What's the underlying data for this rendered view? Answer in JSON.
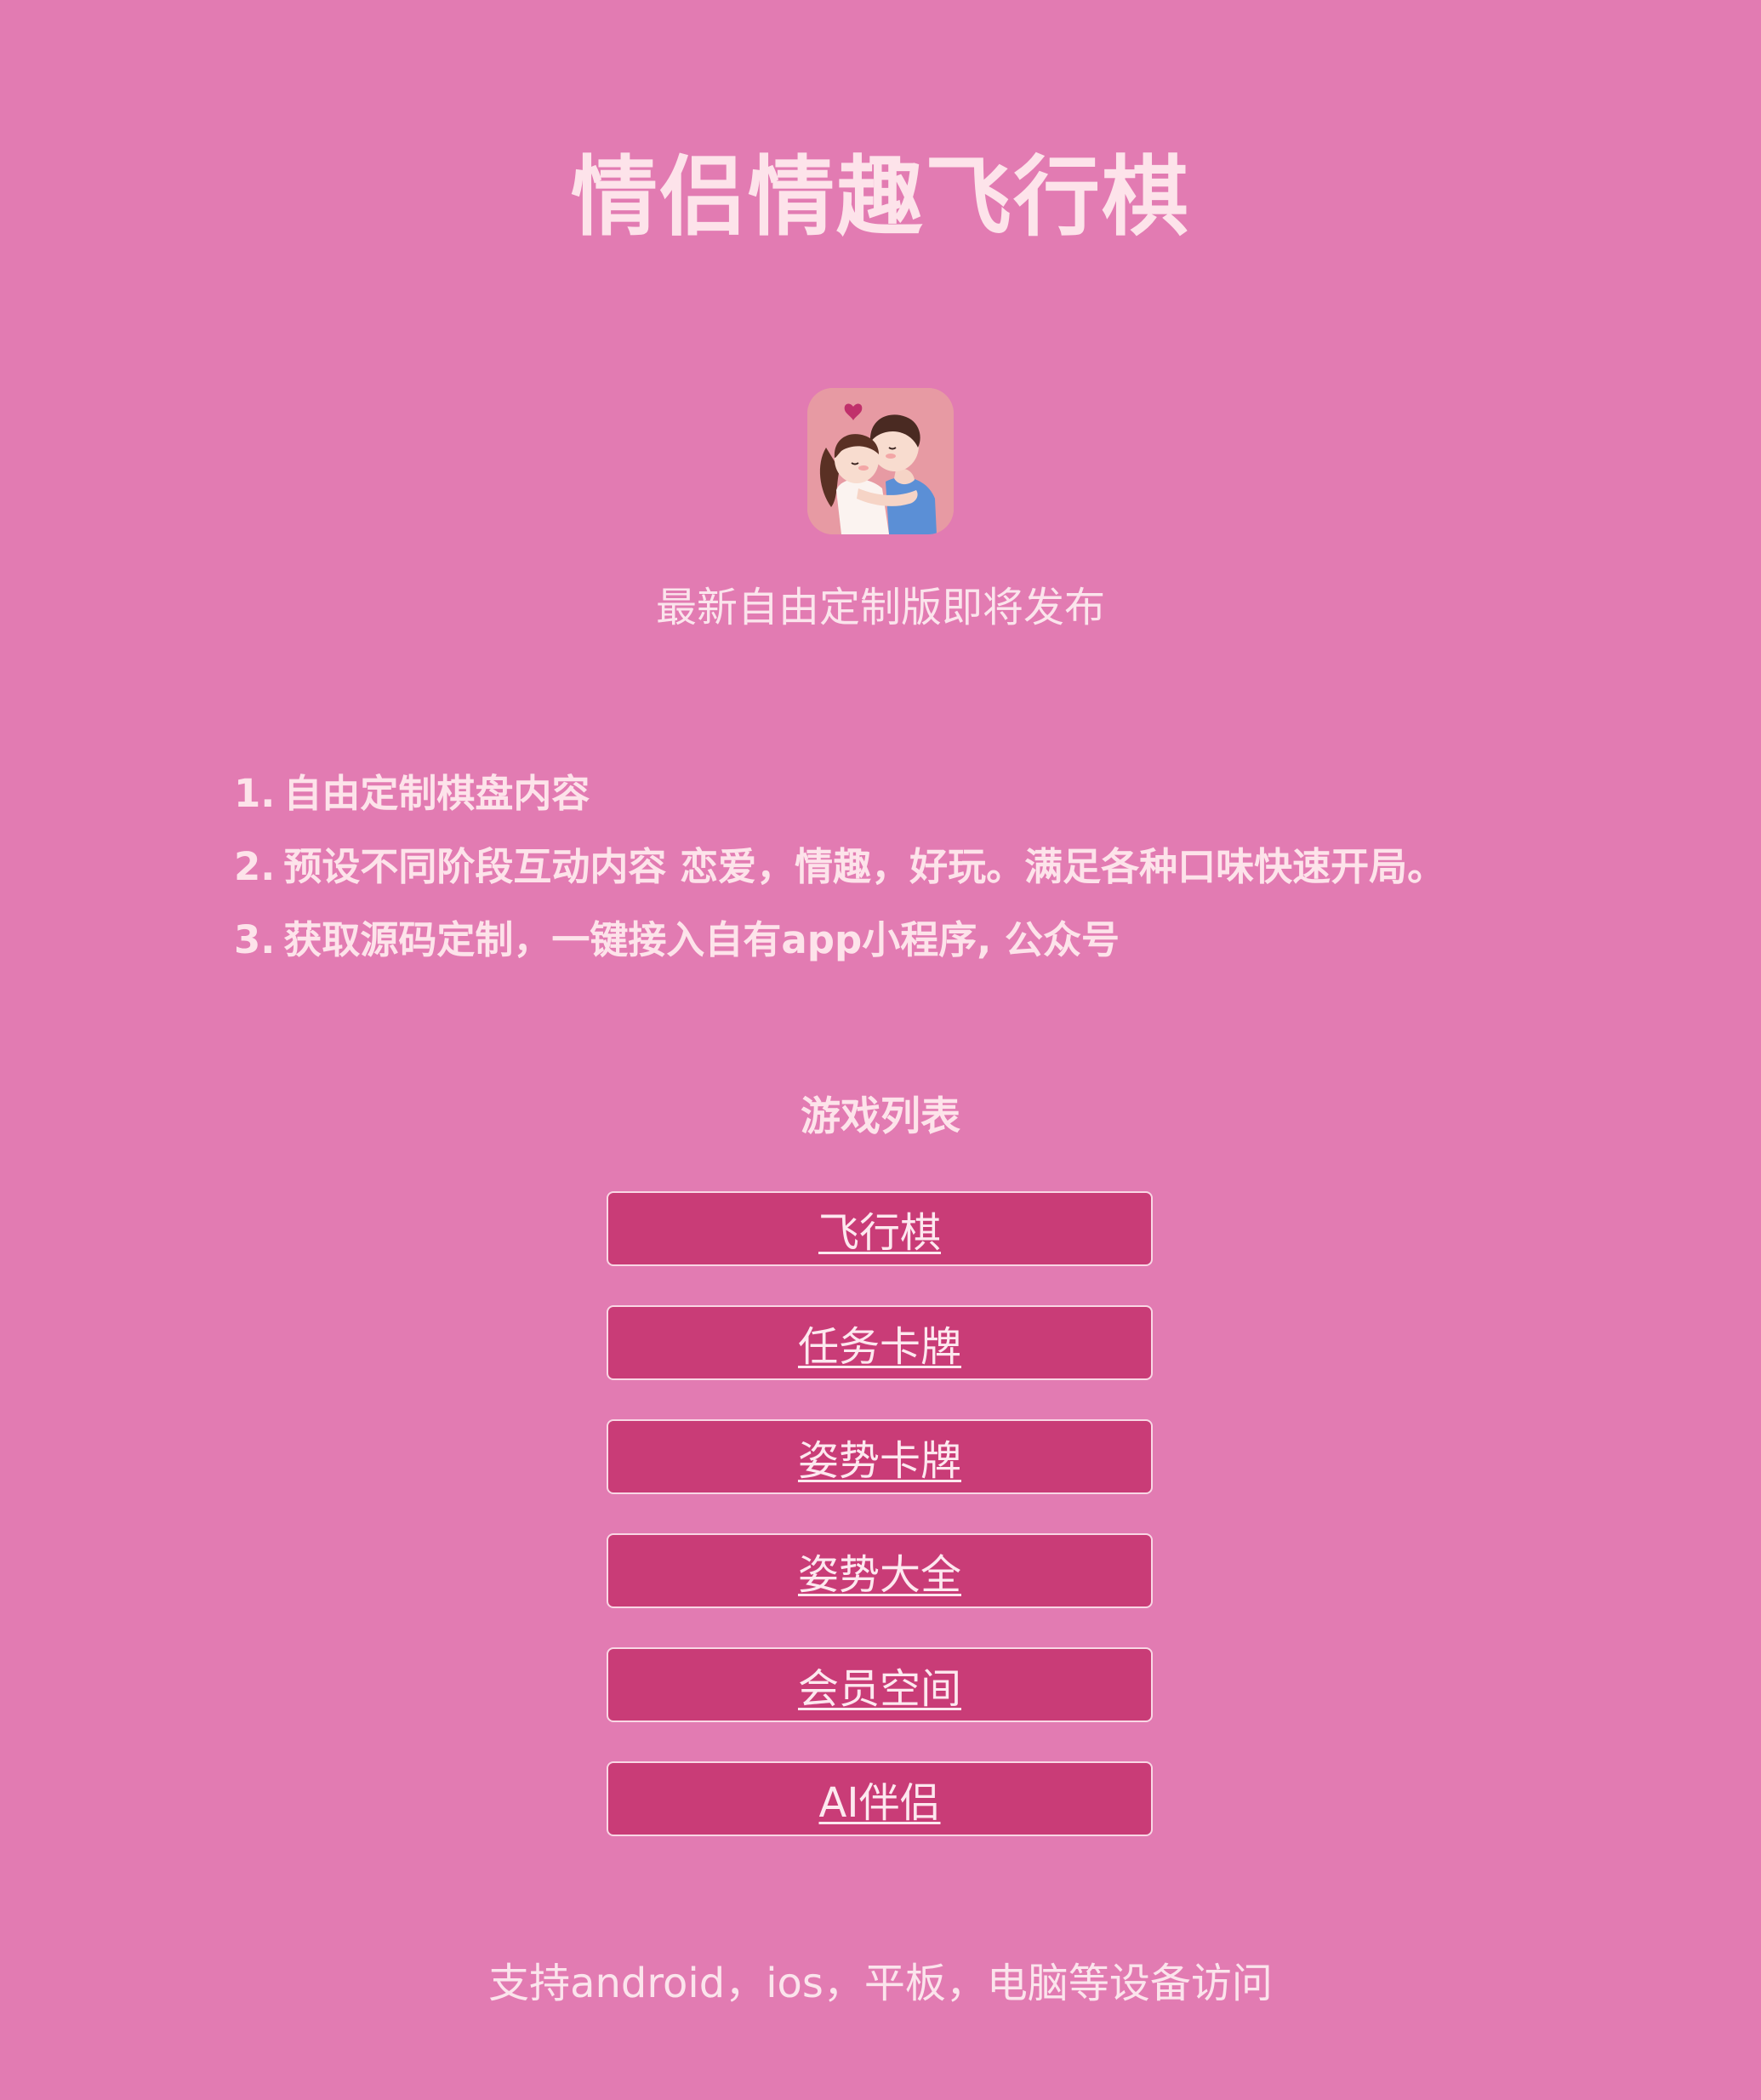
{
  "header": {
    "title": "情侣情趣飞行棋"
  },
  "icon": {
    "name": "couple-hug-app-icon"
  },
  "subtitle": "最新自由定制版即将发布",
  "features": [
    {
      "num": "1.",
      "text": "自由定制棋盘内容"
    },
    {
      "num": "2.",
      "text": "预设不同阶段互动内容 恋爱，情趣，好玩。满足各种口味快速开局。"
    },
    {
      "num": "3.",
      "text": "获取源码定制，一键接入自有app小程序, 公众号"
    }
  ],
  "games": {
    "heading": "游戏列表",
    "items": [
      {
        "label": "飞行棋"
      },
      {
        "label": "任务卡牌"
      },
      {
        "label": "姿势卡牌"
      },
      {
        "label": "姿势大全"
      },
      {
        "label": "会员空间"
      },
      {
        "label": "AI伴侣"
      }
    ]
  },
  "footer": "支持android，ios，平板，电脑等设备访问",
  "colors": {
    "background": "#e27bb2",
    "button": "#c93c77",
    "text": "#fde3ea"
  }
}
